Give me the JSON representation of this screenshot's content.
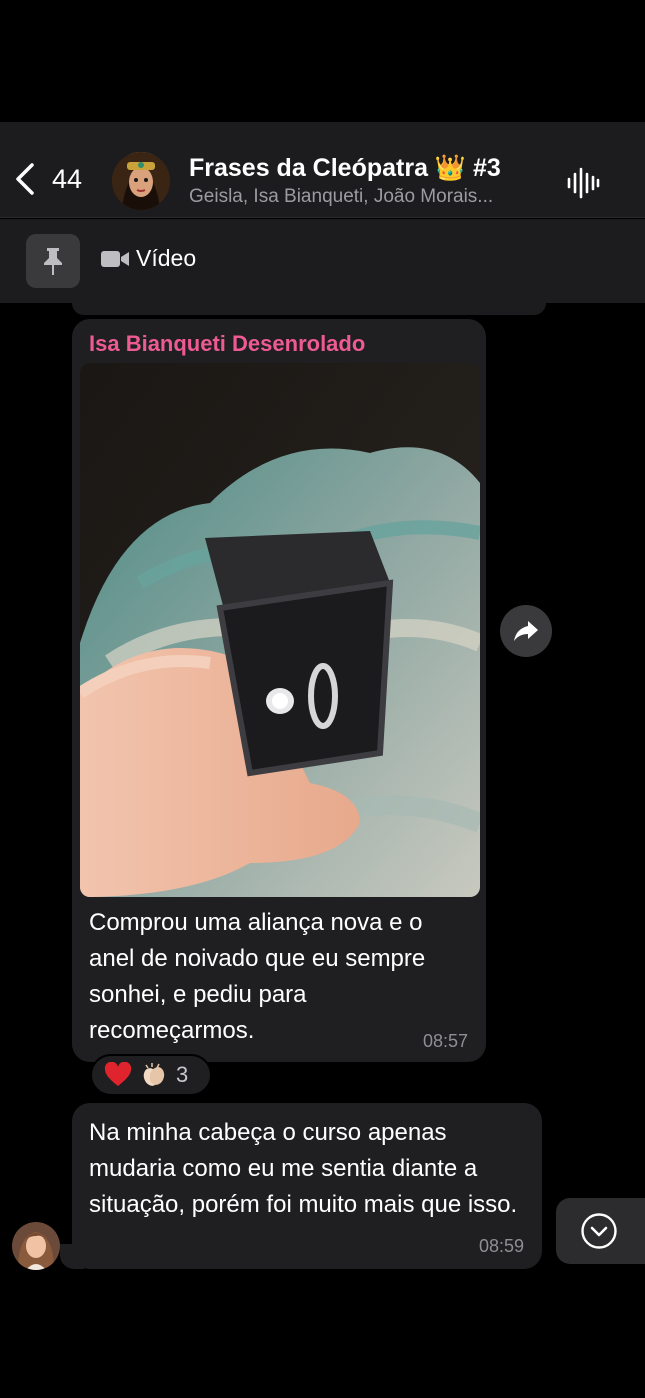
{
  "header": {
    "back_count": "44",
    "title": "Frases da Cleópatra 👑 #3",
    "members": "Geisla, Isa Bianqueti, João Morais..."
  },
  "pinned": {
    "media_label": "Vídeo"
  },
  "messages": [
    {
      "sender": "Isa Bianqueti Desenrolado",
      "text": "Comprou uma aliança nova e o anel de noivado que eu sempre sonhei, e pediu para recomeçarmos.",
      "time": "08:57",
      "reactions": {
        "emojis": [
          "red-heart",
          "clapping-hands"
        ],
        "count": "3"
      }
    },
    {
      "text": "Na minha cabeça o curso apenas mudaria como eu me sentia diante a situação, porém foi muito mais que isso.",
      "time": "08:59"
    }
  ],
  "colors": {
    "sender_name": "#ee5a93",
    "bubble": "#1f1f21",
    "header_bg": "#1c1c1e",
    "timestamp": "#8e8e93"
  }
}
